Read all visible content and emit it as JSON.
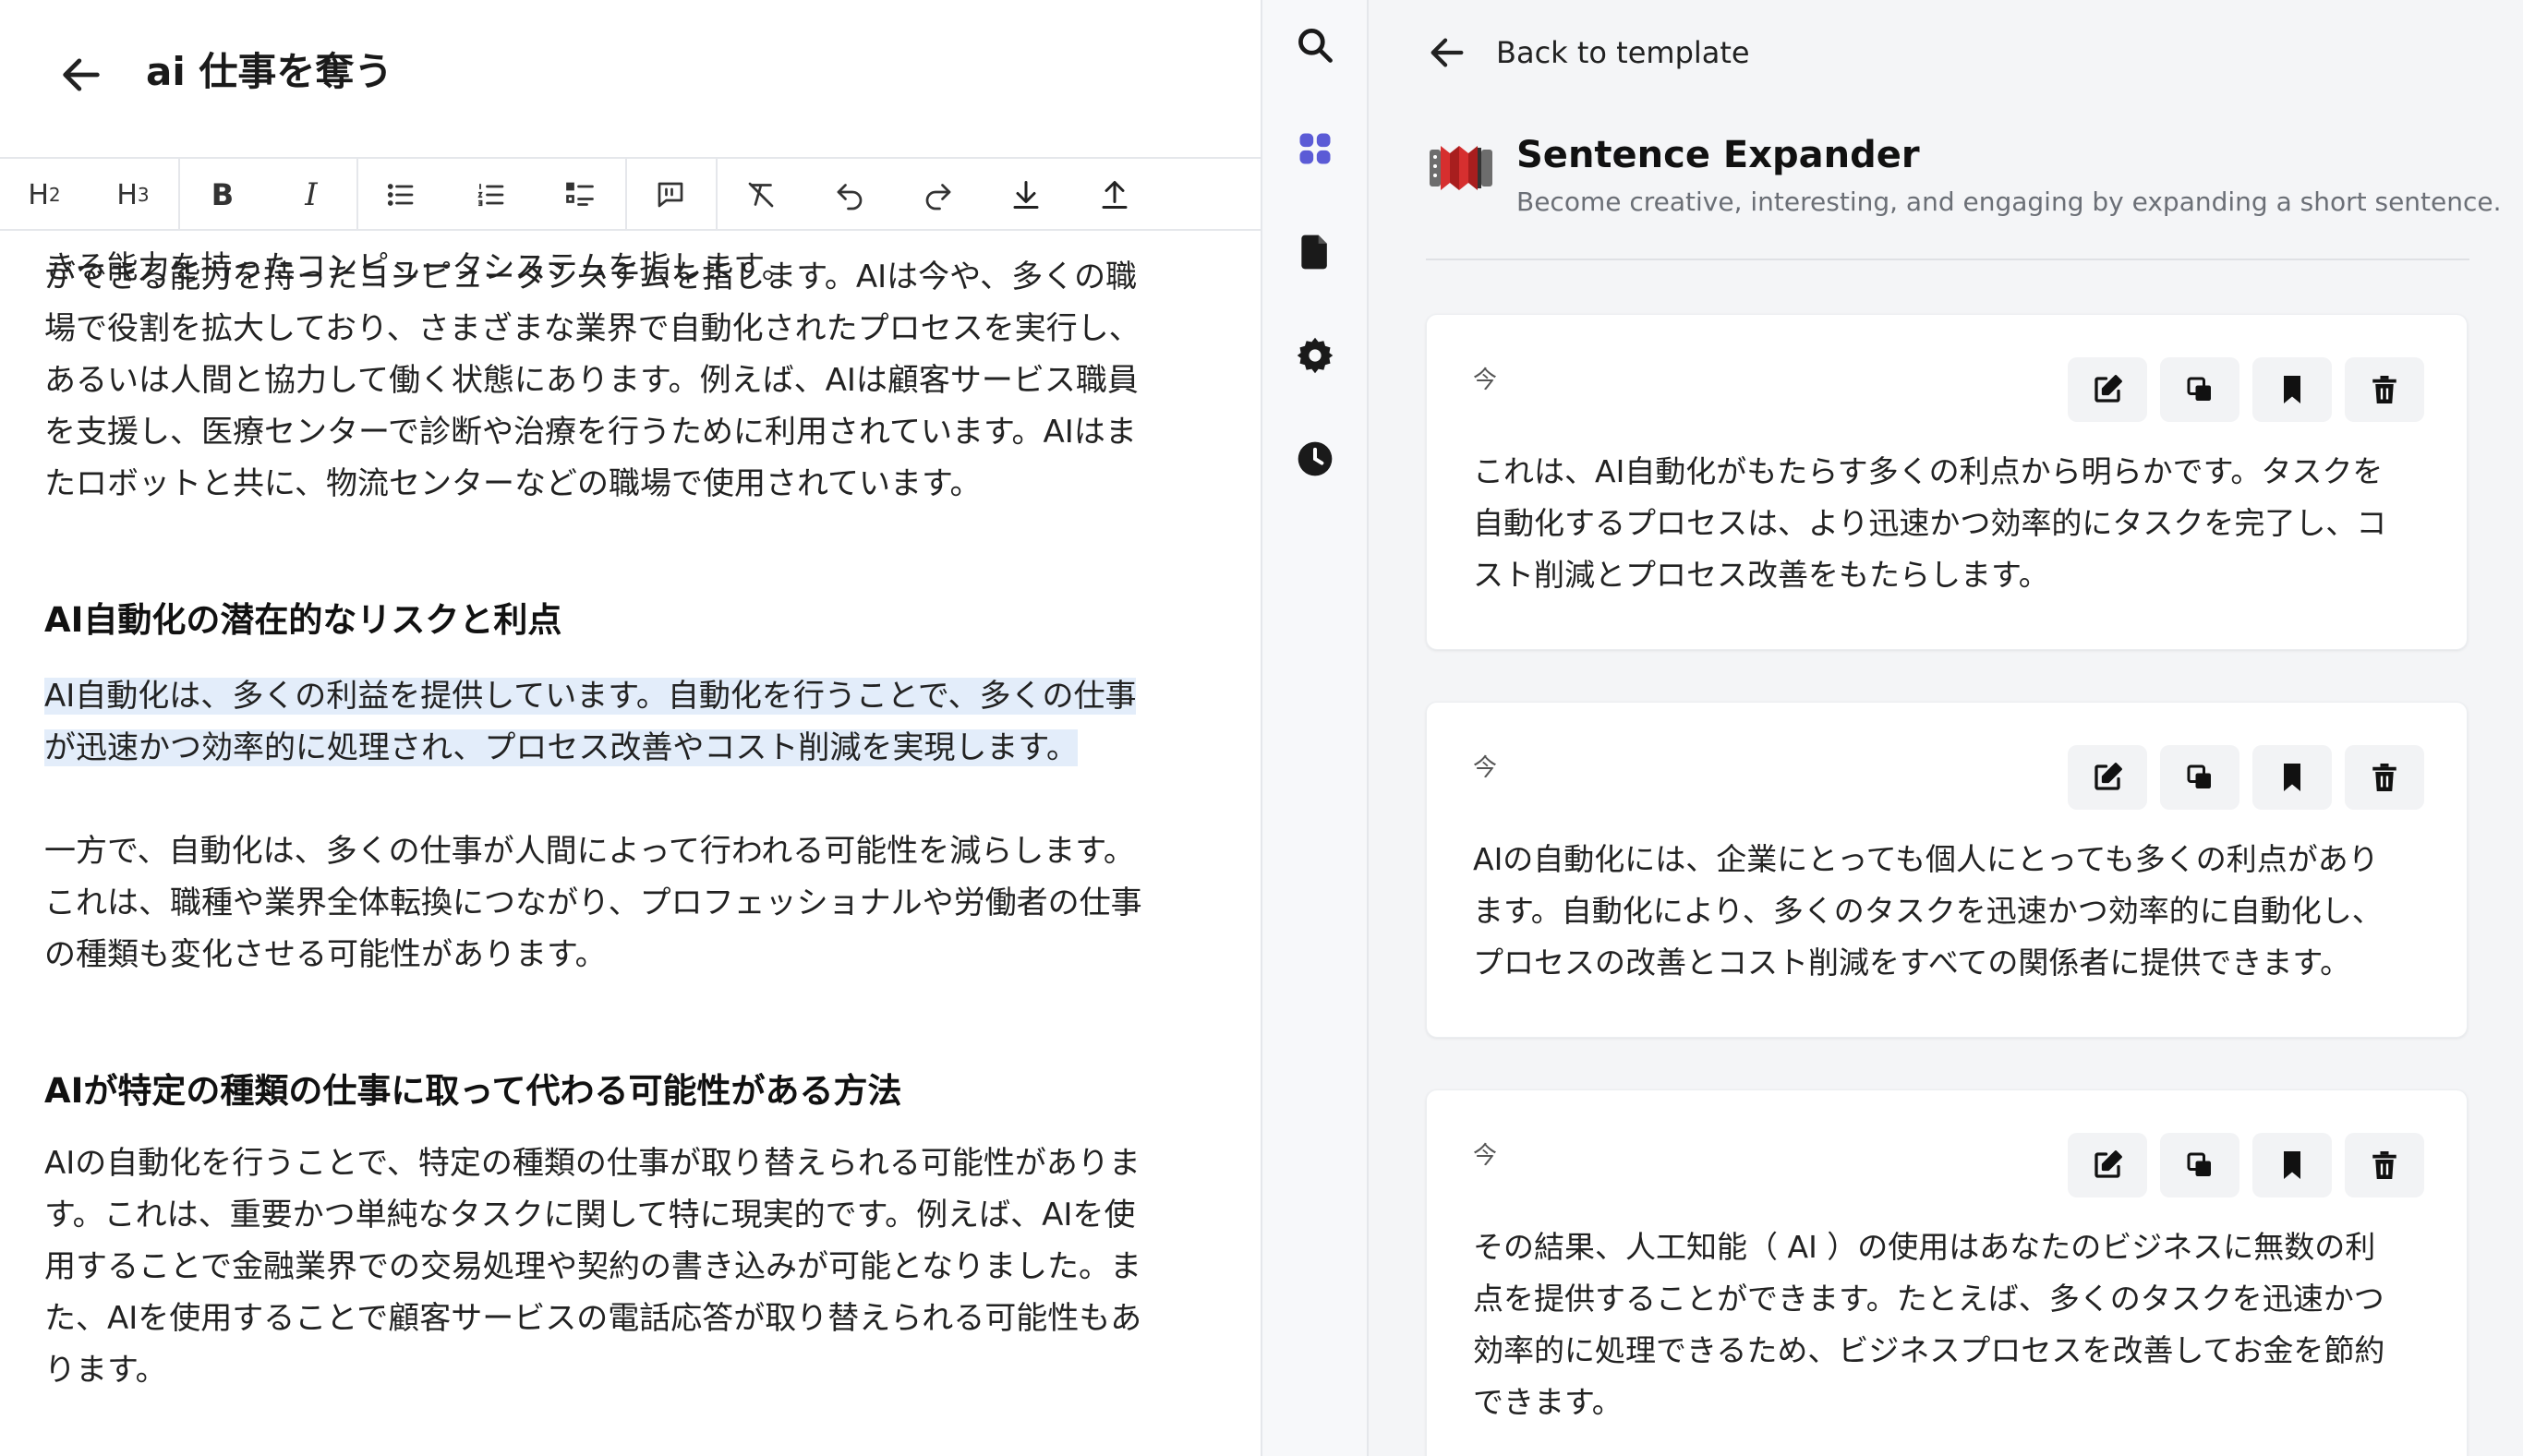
{
  "editor": {
    "title": "ai 仕事を奪う",
    "toolbar": {
      "h2": "H",
      "h2_sub": "2",
      "h3": "H",
      "h3_sub": "3",
      "bold": "B",
      "italic": "I"
    },
    "content": {
      "p1_clipped": "人工知能（AI）は、コンピュータプログラムを使用して決定や判断を行うことができる能力を持ったコンピュータシステムを指します。",
      "p1_line1": "ができる能力を持ったコンピュータシステムを指します。AIは今や、多くの職",
      "p1_line2": "場で役割を拡大しており、さまざまな業界で自動化されたプロセスを実行し、",
      "p1_line3": "あるいは人間と協力して働く状態にあります。例えば、AIは顧客サービス職員",
      "p1_line4": "を支援し、医療センターで診断や治療を行うために利用されています。AIはま",
      "p1_line5": "たロボットと共に、物流センターなどの職場で使用されています。",
      "h_risk": "AI自動化の潜在的なリスクと利点",
      "p2_line1": "AI自動化は、多くの利益を提供しています。自動化を行うことで、多くの仕事",
      "p2_line2": "が迅速かつ効率的に処理され、プロセス改善やコスト削減を実現します。",
      "p3_line1": "一方で、自動化は、多くの仕事が人間によって行われる可能性を減らします。",
      "p3_line2": "これは、職種や業界全体転換につながり、プロフェッショナルや労働者の仕事",
      "p3_line3": "の種類も変化させる可能性があります。",
      "h_replace": "AIが特定の種類の仕事に取って代わる可能性がある方法",
      "p4_line1": "AIの自動化を行うことで、特定の種類の仕事が取り替えられる可能性がありま",
      "p4_line2": "す。これは、重要かつ単純なタスクに関して特に現実的です。例えば、AIを使",
      "p4_line3": "用することで金融業界での交易処理や契約の書き込みが可能となりました。ま",
      "p4_line4": "た、AIを使用することで顧客サービスの電話応答が取り替えられる可能性もあ",
      "p4_line5": "ります。"
    }
  },
  "rail": {
    "items": [
      "search-icon",
      "apps-icon",
      "document-icon",
      "settings-icon",
      "history-icon"
    ],
    "active_color": "#5b5bd6"
  },
  "panel": {
    "back_label": "Back to template",
    "template_name": "Sentence Expander",
    "template_description": "Become creative, interesting, and engaging by expanding a short sentence.",
    "results": [
      {
        "time": "今",
        "lines": [
          "これは、AI自動化がもたらす多くの利点から明らかです。タスクを",
          "自動化するプロセスは、より迅速かつ効率的にタスクを完了し、コ",
          "スト削減とプロセス改善をもたらします。"
        ]
      },
      {
        "time": "今",
        "lines": [
          "AIの自動化には、企業にとっても個人にとっても多くの利点があり",
          "ます。自動化により、多くのタスクを迅速かつ効率的に自動化し、",
          "プロセスの改善とコスト削減をすべての関係者に提供できます。"
        ]
      },
      {
        "time": "今",
        "lines": [
          "その結果、人工知能（ AI ）の使用はあなたのビジネスに無数の利",
          "点を提供することができます。たとえば、多くのタスクを迅速かつ",
          "効率的に処理できるため、ビジネスプロセスを改善してお金を節約",
          "できます。"
        ]
      }
    ]
  },
  "colors": {
    "highlight": "#e3edfa",
    "panel_bg": "#f4f5f7",
    "accent": "#5b5bd6"
  }
}
